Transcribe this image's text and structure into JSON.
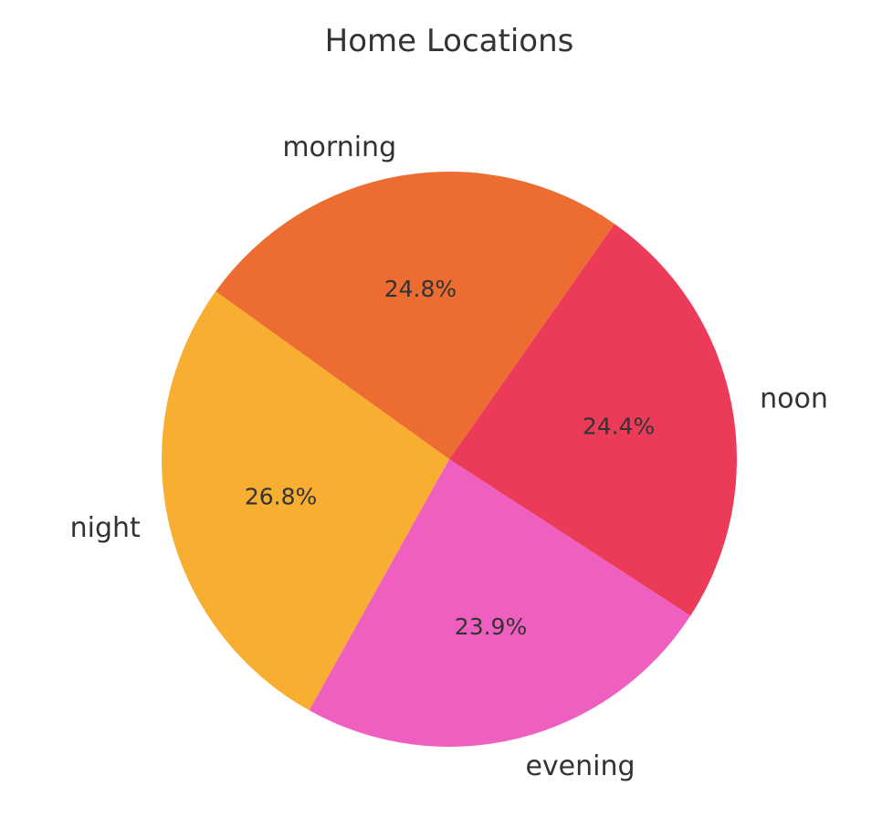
{
  "chart_data": {
    "type": "pie",
    "title": "Home Locations",
    "slices": [
      {
        "label": "noon",
        "value": 24.4,
        "pct_label": "24.4%",
        "color": "#ec3b58"
      },
      {
        "label": "morning",
        "value": 24.8,
        "pct_label": "24.8%",
        "color": "#ed6c31"
      },
      {
        "label": "night",
        "value": 26.8,
        "pct_label": "26.8%",
        "color": "#f8ae31"
      },
      {
        "label": "evening",
        "value": 23.9,
        "pct_label": "23.9%",
        "color": "#ef5fc0"
      }
    ],
    "legend": "none"
  }
}
